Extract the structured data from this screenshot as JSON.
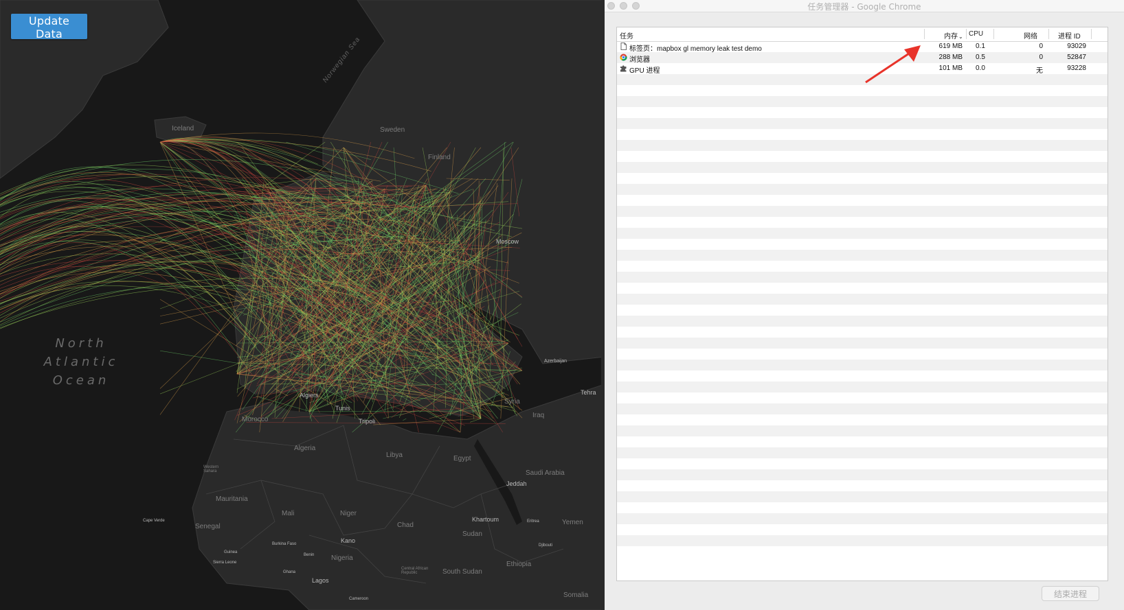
{
  "map": {
    "update_button": "Update Data",
    "labels": {
      "iceland": "Iceland",
      "norwegian_sea": "Norwegian Sea",
      "sweden": "Sweden",
      "finland": "Finland",
      "moscow": "Moscow",
      "ocean_1": "North",
      "ocean_2": "Atlantic",
      "ocean_3": "Ocean",
      "morocco": "Morocco",
      "algiers": "Algiers",
      "tunis": "Tunis",
      "tripoli": "Tripoli",
      "syria": "Syria",
      "iraq": "Iraq",
      "tehran": "Tehra",
      "algeria": "Algeria",
      "libya": "Libya",
      "egypt": "Egypt",
      "saudi_arabia": "Saudi Arabia",
      "jeddah": "Jeddah",
      "western_sahara": "Western Sahara",
      "mauritania": "Mauritania",
      "mali": "Mali",
      "niger": "Niger",
      "chad": "Chad",
      "khartoum": "Khartoum",
      "sudan": "Sudan",
      "yemen": "Yemen",
      "cape_verde": "Cape Verde",
      "senegal": "Senegal",
      "kano": "Kano",
      "nigeria": "Nigeria",
      "south_sudan": "South Sudan",
      "ethiopia": "Ethiopia",
      "somalia": "Somalia",
      "lagos": "Lagos",
      "central_african_republic": "Central African Republic",
      "guinea": "Guinea",
      "sierra_leone": "Sierra Leone",
      "burkina_faso": "Burkina Faso",
      "ghana": "Ghana",
      "benin": "Benin",
      "eritrea": "Eritrea",
      "djibouti": "Djibouti",
      "cameroon": "Cameroon",
      "azerbaijan": "Azerbaijan"
    }
  },
  "task_manager": {
    "window_title": "任务管理器 - Google Chrome",
    "columns": {
      "task": "任务",
      "memory": "内存",
      "cpu": "CPU",
      "network": "网络",
      "pid": "进程 ID"
    },
    "rows": [
      {
        "icon": "document-icon",
        "task": "标签页：mapbox gl memory leak test demo",
        "memory": "619 MB",
        "cpu": "0.1",
        "network": "0",
        "pid": "93029"
      },
      {
        "icon": "chrome-icon",
        "task": "浏览器",
        "memory": "288 MB",
        "cpu": "0.5",
        "network": "0",
        "pid": "52847"
      },
      {
        "icon": "puzzle-icon",
        "task": "GPU 进程",
        "memory": "101 MB",
        "cpu": "0.0",
        "network": "无",
        "pid": "93228"
      }
    ],
    "end_process_button": "结束进程"
  },
  "annotation": {
    "arrow_color": "#e8332a"
  },
  "colors": {
    "button_blue": "#3a8ed2",
    "flow_green": "#6fd36a",
    "flow_orange": "#e0a24a",
    "flow_red": "#c8463e"
  }
}
